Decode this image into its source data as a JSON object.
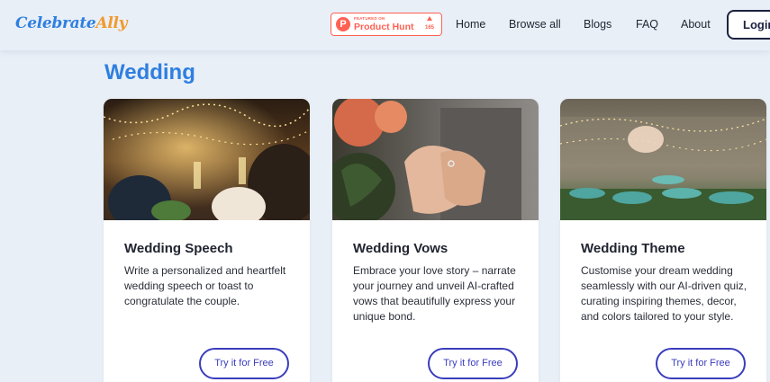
{
  "header": {
    "logo": {
      "part1": "Celebrate",
      "part2": "Ally"
    },
    "product_hunt": {
      "featured": "FEATURED ON",
      "name": "Product Hunt",
      "count": "165"
    },
    "nav": [
      "Home",
      "Browse all",
      "Blogs",
      "FAQ",
      "About"
    ],
    "login": "Login"
  },
  "section": {
    "title": "Wedding",
    "cards": [
      {
        "title": "Wedding Speech",
        "description": "Write a personalized and heartfelt wedding speech or toast to congratulate the couple.",
        "button": "Try it for Free"
      },
      {
        "title": "Wedding Vows",
        "description": "Embrace your love story – narrate your journey and unveil AI-crafted vows that beautifully express your unique bond.",
        "button": "Try it for Free"
      },
      {
        "title": "Wedding Theme",
        "description": "Customise your dream wedding seamlessly with our AI-driven quiz, curating inspiring themes, decor, and colors tailored to your style.",
        "button": "Try it for Free"
      }
    ]
  },
  "colors": {
    "accent": "#2f7fe0",
    "logo_orange": "#f29a2e",
    "product_hunt": "#ff6154",
    "button": "#3a3dbd",
    "background": "#e9eff7"
  }
}
